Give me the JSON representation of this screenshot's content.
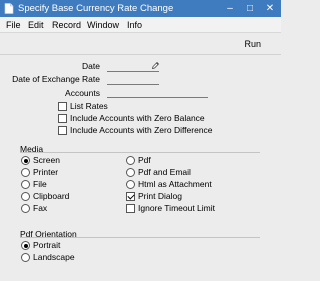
{
  "window": {
    "title": "Specify Base Currency Rate Change",
    "minimize_glyph": "–",
    "maximize_glyph": "□",
    "close_glyph": "✕"
  },
  "menu": {
    "items": [
      {
        "label": "File"
      },
      {
        "label": "Edit"
      },
      {
        "label": "Record"
      },
      {
        "label": "Window"
      },
      {
        "label": "Info"
      }
    ]
  },
  "toolbar": {
    "run_label": "Run"
  },
  "form": {
    "date_label": "Date",
    "date_value": "",
    "exchange_date_label": "Date of Exchange Rate",
    "exchange_date_value": "",
    "accounts_label": "Accounts",
    "accounts_value": "",
    "options": [
      {
        "label": "List Rates",
        "checked": false
      },
      {
        "label": "Include Accounts with Zero Balance",
        "checked": false
      },
      {
        "label": "Include Accounts with Zero Difference",
        "checked": false
      }
    ]
  },
  "media": {
    "heading": "Media",
    "left": [
      {
        "label": "Screen",
        "selected": true
      },
      {
        "label": "Printer",
        "selected": false
      },
      {
        "label": "File",
        "selected": false
      },
      {
        "label": "Clipboard",
        "selected": false
      },
      {
        "label": "Fax",
        "selected": false
      }
    ],
    "right_radios": [
      {
        "label": "Pdf",
        "selected": false
      },
      {
        "label": "Pdf and Email",
        "selected": false
      },
      {
        "label": "Html as Attachment",
        "selected": false
      }
    ],
    "right_checks": [
      {
        "label": "Print Dialog",
        "checked": true
      },
      {
        "label": "Ignore Timeout Limit",
        "checked": false
      }
    ]
  },
  "pdf_orientation": {
    "heading": "Pdf Orientation",
    "options": [
      {
        "label": "Portrait",
        "selected": true
      },
      {
        "label": "Landscape",
        "selected": false
      }
    ]
  },
  "colors": {
    "titlebar": "#3f7bbf",
    "window_bg": "#ececec"
  },
  "icons": {
    "app": "document-icon",
    "date_field": "pencil-icon"
  }
}
